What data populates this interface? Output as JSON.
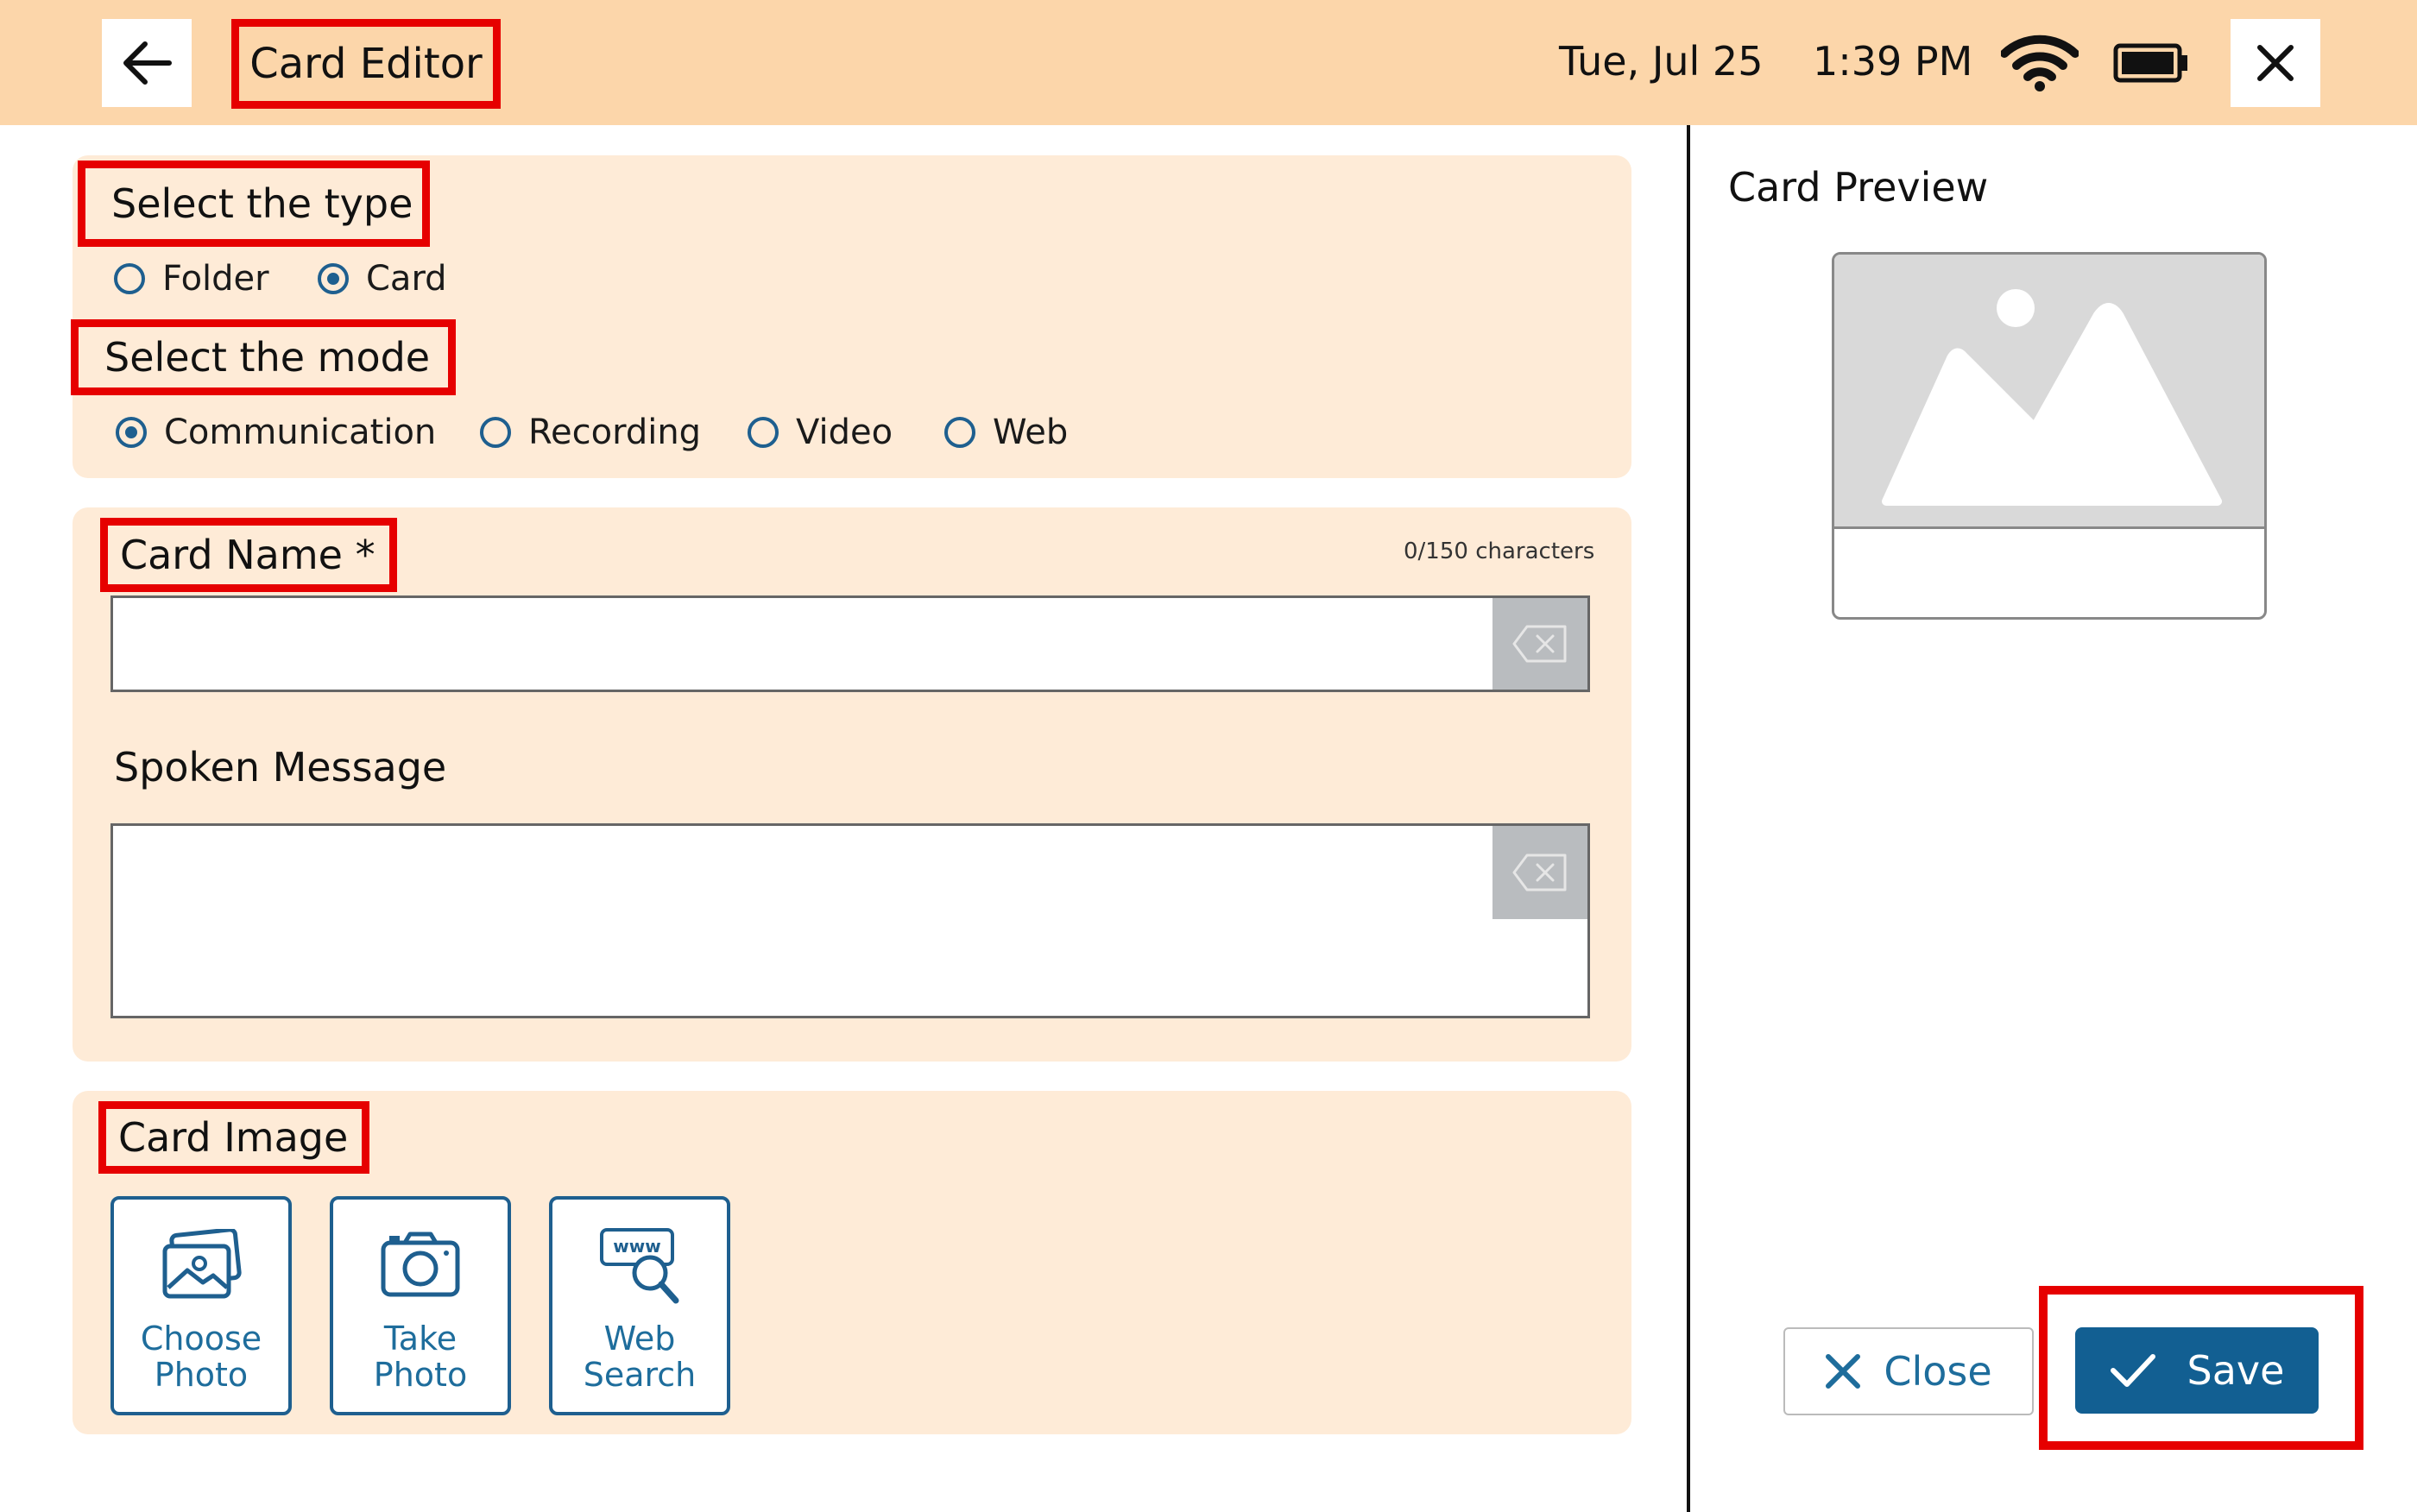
{
  "header": {
    "title": "Card Editor",
    "date": "Tue, Jul 25",
    "time": "1:39 PM"
  },
  "type_section": {
    "label": "Select the type",
    "options": [
      {
        "label": "Folder",
        "checked": false
      },
      {
        "label": "Card",
        "checked": true
      }
    ]
  },
  "mode_section": {
    "label": "Select the mode",
    "options": [
      {
        "label": "Communication",
        "checked": true
      },
      {
        "label": "Recording",
        "checked": false
      },
      {
        "label": "Video",
        "checked": false
      },
      {
        "label": "Web",
        "checked": false
      }
    ]
  },
  "card_name": {
    "label": "Card Name *",
    "char_count": "0/150 characters",
    "value": ""
  },
  "spoken_message": {
    "label": "Spoken Message",
    "value": ""
  },
  "card_image": {
    "label": "Card Image",
    "buttons": [
      {
        "line1": "Choose",
        "line2": "Photo"
      },
      {
        "line1": "Take",
        "line2": "Photo"
      },
      {
        "line1": "Web",
        "line2": "Search"
      }
    ],
    "web_icon_text": "www"
  },
  "preview": {
    "title": "Card Preview"
  },
  "actions": {
    "close_label": "Close",
    "save_label": "Save"
  },
  "colors": {
    "header_bg": "#fcd6aa",
    "panel_bg": "#feebd7",
    "accent": "#1e5f8f",
    "save_bg": "#125f92",
    "highlight": "#e60000"
  }
}
